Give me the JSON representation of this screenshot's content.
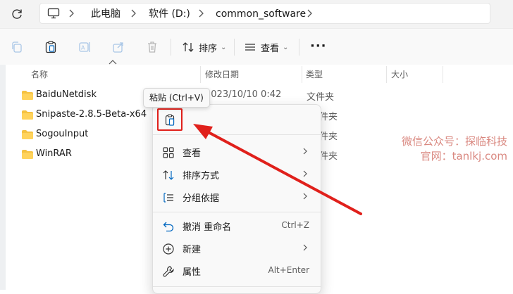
{
  "breadcrumbs": [
    "此电脑",
    "软件 (D:)",
    "common_software"
  ],
  "toolbar": {
    "sort_label": "排序",
    "view_label": "查看",
    "more_label": "···"
  },
  "columns": {
    "name": "名称",
    "modified": "修改日期",
    "type": "类型",
    "size": "大小"
  },
  "files": [
    {
      "name": "BaiduNetdisk",
      "modified": "2023/10/10 0:42",
      "type": "文件夹"
    },
    {
      "name": "Snipaste-2.8.5-Beta-x64",
      "modified": "",
      "type": "件夹"
    },
    {
      "name": "SogouInput",
      "modified": "",
      "type": "件夹"
    },
    {
      "name": "WinRAR",
      "modified": "",
      "type": "件夹"
    }
  ],
  "tooltip": "粘贴 (Ctrl+V)",
  "context_menu": {
    "items": [
      {
        "label": "查看",
        "icon": "grid-view-icon",
        "shortcut": "",
        "submenu": true
      },
      {
        "label": "排序方式",
        "icon": "sort-icon",
        "shortcut": "",
        "submenu": true
      },
      {
        "label": "分组依据",
        "icon": "group-by-icon",
        "shortcut": "",
        "submenu": true
      },
      {
        "label": "撤消 重命名",
        "icon": "undo-icon",
        "shortcut": "Ctrl+Z",
        "submenu": false
      },
      {
        "label": "新建",
        "icon": "new-icon",
        "shortcut": "",
        "submenu": true
      },
      {
        "label": "属性",
        "icon": "wrench-icon",
        "shortcut": "Alt+Enter",
        "submenu": false
      }
    ]
  },
  "watermark": {
    "line1": "微信公众号：探临科技",
    "line2": "官网：tanlkj.com"
  },
  "colors": {
    "highlight": "#e0201b",
    "arrow": "#e0201b",
    "folder": "#f5c242",
    "accent": "#0067c0"
  }
}
